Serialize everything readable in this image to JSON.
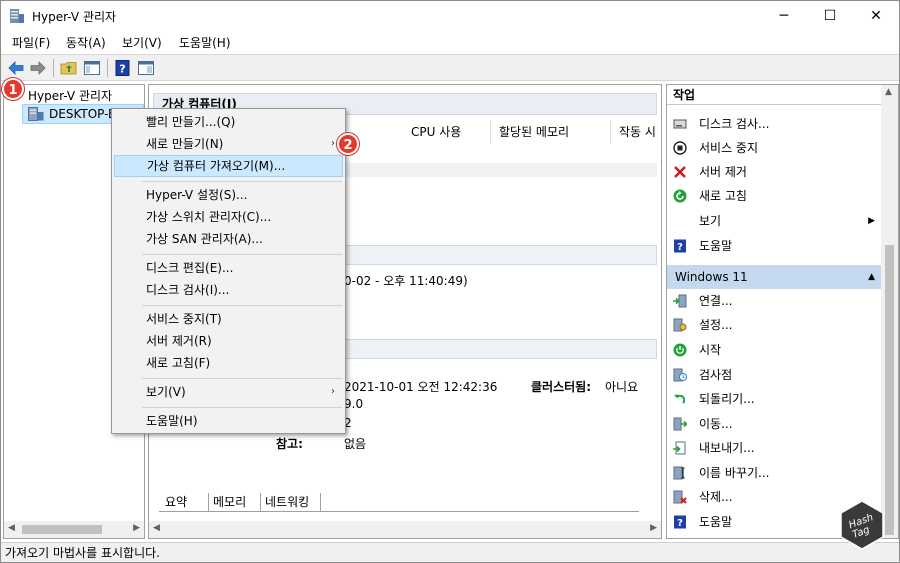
{
  "window": {
    "title": "Hyper-V 관리자",
    "controls": {
      "minimize": "─",
      "maximize": "☐",
      "close": "✕"
    }
  },
  "menubar": [
    "파일(F)",
    "동작(A)",
    "보기(V)",
    "도움말(H)"
  ],
  "toolbar": {
    "icons": [
      "back-arrow-icon",
      "forward-arrow-icon",
      "folder-up-icon",
      "show-hide-tree-icon",
      "help-icon",
      "show-hide-action-pane-icon"
    ]
  },
  "tree": {
    "root": "Hyper-V 관리자",
    "child": "DESKTOP-BMVK"
  },
  "center": {
    "vm_section": "가상 컴퓨터(I)",
    "columns": [
      "CPU 사용",
      "할당된 메모리",
      "작동 시"
    ],
    "details": {
      "snapshot_time": "0-02 - 오후 11:40:49)",
      "created": "2021-10-01 오전 12:42:36",
      "clustered_label": "클러스터됨:",
      "clustered_value": "아니요",
      "version": "9.0",
      "generation": "2",
      "notes_label": "참고:",
      "notes_value": "없음"
    },
    "tabs": [
      "요약",
      "메모리",
      "네트워킹"
    ]
  },
  "context_menu": {
    "items": [
      {
        "label": "빨리 만들기...(Q)",
        "submenu": false
      },
      {
        "label": "새로 만들기(N)",
        "submenu": true
      },
      {
        "label": "가상 컴퓨터 가져오기(M)...",
        "submenu": false,
        "highlighted": true
      },
      {
        "label": "Hyper-V 설정(S)...",
        "submenu": false
      },
      {
        "label": "가상 스위치 관리자(C)...",
        "submenu": false
      },
      {
        "label": "가상 SAN 관리자(A)...",
        "submenu": false
      },
      {
        "label": "디스크 편집(E)...",
        "submenu": false
      },
      {
        "label": "디스크 검사(I)...",
        "submenu": false
      },
      {
        "label": "서비스 중지(T)",
        "submenu": false
      },
      {
        "label": "서버 제거(R)",
        "submenu": false
      },
      {
        "label": "새로 고침(F)",
        "submenu": false
      },
      {
        "label": "보기(V)",
        "submenu": true
      },
      {
        "label": "도움말(H)",
        "submenu": false
      }
    ]
  },
  "badges": [
    "1",
    "2"
  ],
  "actions": {
    "title": "작업",
    "host_items": [
      {
        "label": "디스크 검사...",
        "icon": "disk-icon"
      },
      {
        "label": "서비스 중지",
        "icon": "stop-icon"
      },
      {
        "label": "서버 제거",
        "icon": "red-x-icon"
      },
      {
        "label": "새로 고침",
        "icon": "refresh-icon"
      },
      {
        "label": "보기",
        "icon": "none"
      },
      {
        "label": "도움말",
        "icon": "help-icon"
      }
    ],
    "group": "Windows 11",
    "vm_items": [
      {
        "label": "연결...",
        "icon": "connect-icon"
      },
      {
        "label": "설정...",
        "icon": "settings-icon"
      },
      {
        "label": "시작",
        "icon": "start-icon"
      },
      {
        "label": "검사점",
        "icon": "checkpoint-icon"
      },
      {
        "label": "되돌리기...",
        "icon": "revert-icon"
      },
      {
        "label": "이동...",
        "icon": "move-icon"
      },
      {
        "label": "내보내기...",
        "icon": "export-icon"
      },
      {
        "label": "이름 바꾸기...",
        "icon": "rename-icon"
      },
      {
        "label": "삭제...",
        "icon": "delete-icon"
      },
      {
        "label": "도움말",
        "icon": "help-icon"
      }
    ]
  },
  "statusbar": "가져오기 마법사를 표시합니다.",
  "watermark": "Hash Tag",
  "colors": {
    "selection": "#cce8ff",
    "group_header": "#c5d9ee",
    "badge": "#e23b2e",
    "help_blue": "#1e3fa8"
  }
}
